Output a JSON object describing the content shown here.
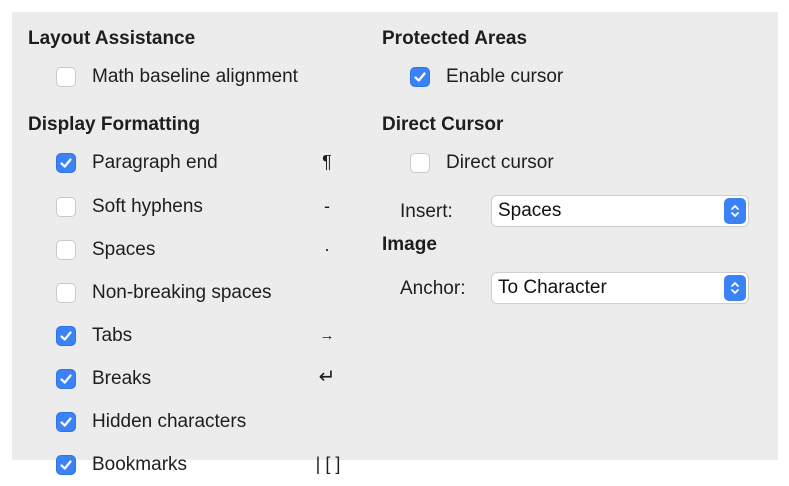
{
  "layout_assistance": {
    "heading": "Layout Assistance",
    "math_baseline": {
      "label": "Math baseline alignment",
      "checked": false
    }
  },
  "display_formatting": {
    "heading": "Display Formatting",
    "items": [
      {
        "label": "Paragraph end",
        "checked": true,
        "symbol": "¶"
      },
      {
        "label": "Soft hyphens",
        "checked": false,
        "symbol": "-"
      },
      {
        "label": "Spaces",
        "checked": false,
        "symbol": "·"
      },
      {
        "label": "Non-breaking spaces",
        "checked": false,
        "symbol": ""
      },
      {
        "label": "Tabs",
        "checked": true,
        "symbol": "→"
      },
      {
        "label": "Breaks",
        "checked": true,
        "symbol": "↵"
      },
      {
        "label": "Hidden characters",
        "checked": true,
        "symbol": ""
      },
      {
        "label": "Bookmarks",
        "checked": true,
        "symbol": "| [ ]"
      }
    ]
  },
  "protected_areas": {
    "heading": "Protected Areas",
    "enable_cursor": {
      "label": "Enable cursor",
      "checked": true
    }
  },
  "direct_cursor": {
    "heading": "Direct Cursor",
    "direct_cursor": {
      "label": "Direct cursor",
      "checked": false
    },
    "insert_label": "Insert:",
    "insert_value": "Spaces"
  },
  "image": {
    "heading": "Image",
    "anchor_label": "Anchor:",
    "anchor_value": "To Character"
  },
  "colors": {
    "accent": "#3b82f6",
    "panel": "#ececec"
  }
}
